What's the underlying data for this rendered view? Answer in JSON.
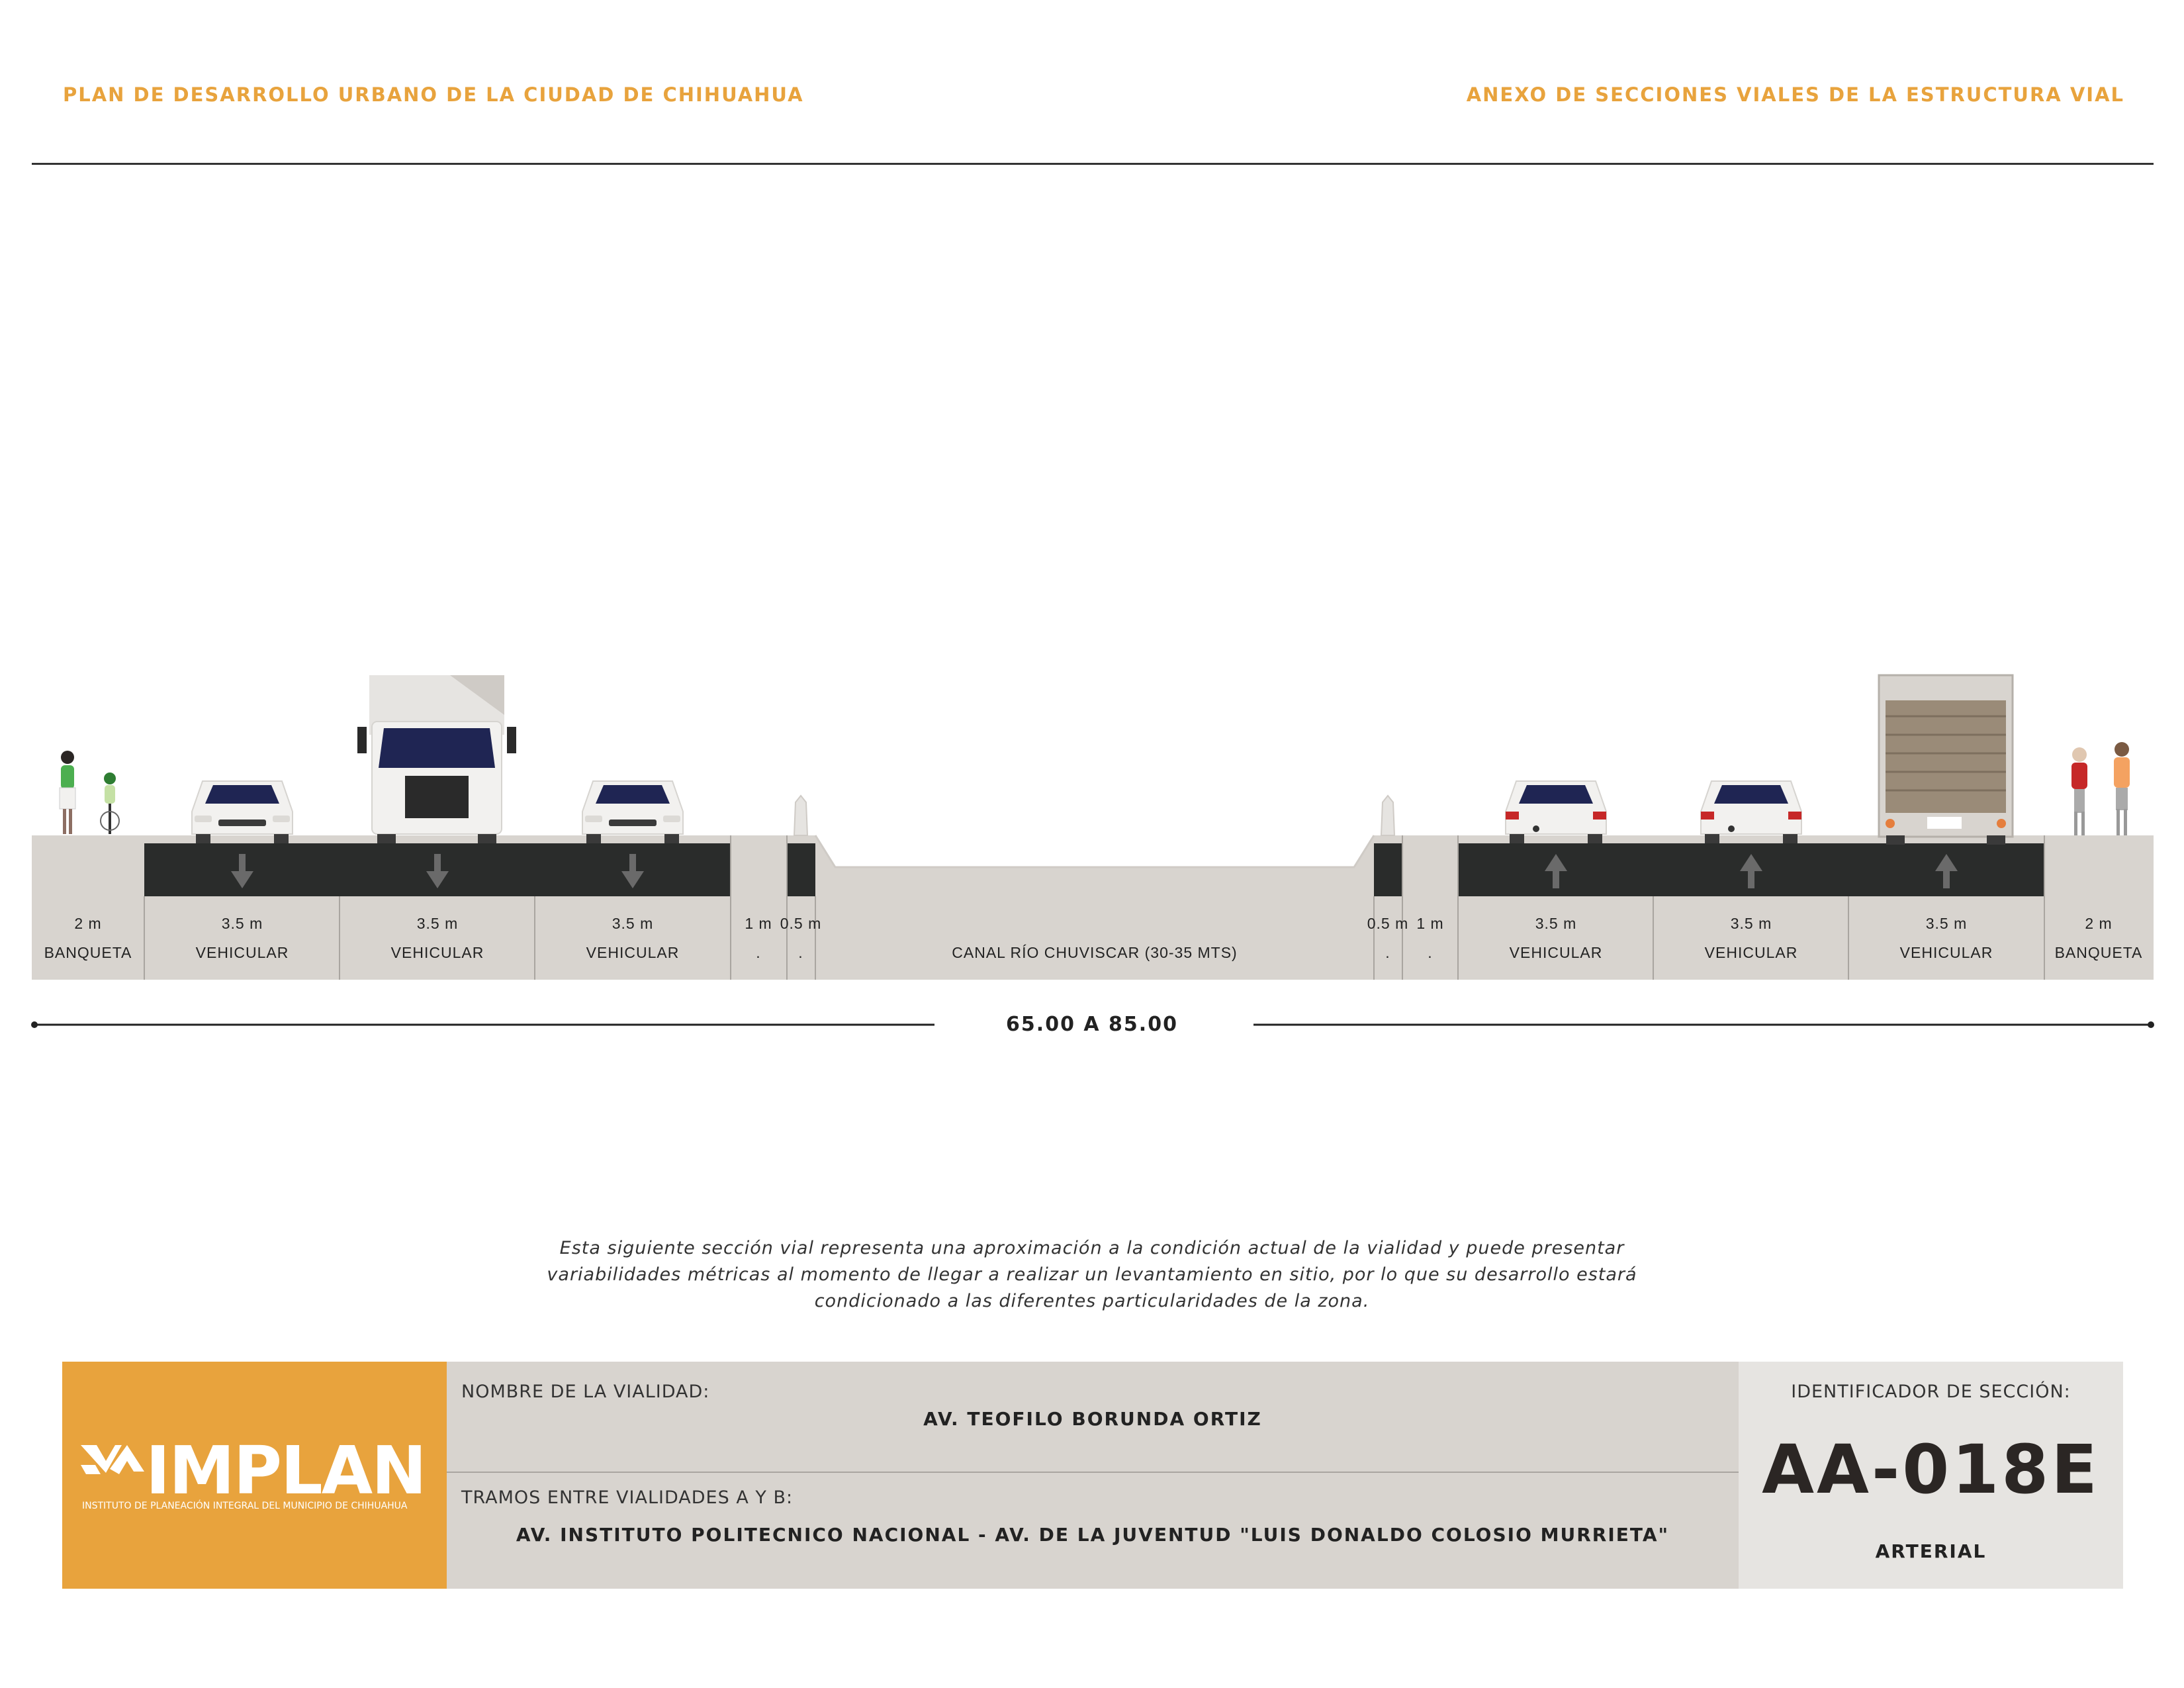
{
  "header": {
    "left_title": "PLAN DE DESARROLLO URBANO DE LA CIUDAD DE CHIHUAHUA",
    "right_title": "ANEXO DE SECCIONES VIALES DE LA ESTRUCTURA VIAL"
  },
  "section": {
    "segments": [
      {
        "width_label": "2 m",
        "type_label": "BANQUETA"
      },
      {
        "width_label": "3.5 m",
        "type_label": "VEHICULAR"
      },
      {
        "width_label": "3.5 m",
        "type_label": "VEHICULAR"
      },
      {
        "width_label": "3.5 m",
        "type_label": "VEHICULAR"
      },
      {
        "width_label": "1 m",
        "type_label": "."
      },
      {
        "width_label": "0.5 m",
        "type_label": "."
      },
      {
        "width_label": "",
        "type_label": "CANAL RÍO CHUVISCAR (30-35 MTS)"
      },
      {
        "width_label": "0.5 m",
        "type_label": "."
      },
      {
        "width_label": "1 m",
        "type_label": "."
      },
      {
        "width_label": "3.5 m",
        "type_label": "VEHICULAR"
      },
      {
        "width_label": "3.5 m",
        "type_label": "VEHICULAR"
      },
      {
        "width_label": "3.5 m",
        "type_label": "VEHICULAR"
      },
      {
        "width_label": "2 m",
        "type_label": "BANQUETA"
      }
    ],
    "total_width": "65.00 A 85.00"
  },
  "disclaimer": {
    "line1": "Esta siguiente sección vial representa una aproximación a la condición actual de la vialidad y puede presentar",
    "line2": "variabilidades métricas al momento de llegar a realizar un levantamiento en sitio, por lo que su desarrollo estará",
    "line3": "condicionado a las diferentes particularidades de la zona."
  },
  "info": {
    "logo_text": "IMPLAN",
    "logo_subtitle": "INSTITUTO DE PLANEACIÓN INTEGRAL DEL MUNICIPIO DE CHIHUAHUA",
    "road_name_label": "NOMBRE DE LA VIALIDAD:",
    "road_name": "AV. TEOFILO BORUNDA ORTIZ",
    "stretch_label": "TRAMOS ENTRE VIALIDADES A Y B:",
    "stretch": "AV. INSTITUTO POLITECNICO NACIONAL - AV. DE LA JUVENTUD \"LUIS DONALDO COLOSIO MURRIETA\"",
    "section_id_label": "IDENTIFICADOR DE SECCIÓN:",
    "section_id": "AA-018E",
    "road_type": "ARTERIAL"
  },
  "colors": {
    "accent": "#e8a33d",
    "asphalt": "#2a2c2b",
    "sidewalk": "#d8d4cf",
    "info_mid": "#d8d4cf",
    "info_id": "#e6e4e1"
  }
}
